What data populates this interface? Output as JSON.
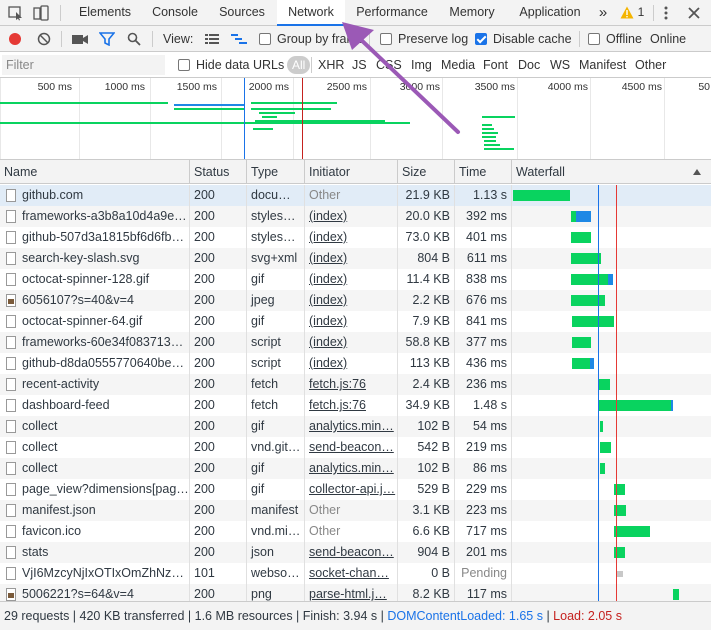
{
  "tabs": {
    "items": [
      {
        "label": "Elements"
      },
      {
        "label": "Console"
      },
      {
        "label": "Sources"
      },
      {
        "label": "Network"
      },
      {
        "label": "Performance"
      },
      {
        "label": "Memory"
      },
      {
        "label": "Application"
      }
    ],
    "more": "»",
    "warnings": "1"
  },
  "toolbar": {
    "view_label": "View:",
    "group_by_frame": "Group by frame",
    "preserve_log": "Preserve log",
    "disable_cache": "Disable cache",
    "offline": "Offline",
    "online": "Online"
  },
  "filter": {
    "placeholder": "Filter",
    "hide_data_urls": "Hide data URLs",
    "types": [
      "All",
      "XHR",
      "JS",
      "CSS",
      "Img",
      "Media",
      "Font",
      "Doc",
      "WS",
      "Manifest",
      "Other"
    ]
  },
  "overview": {
    "ticks": [
      "500 ms",
      "1000 ms",
      "1500 ms",
      "2000 ms",
      "2500 ms",
      "3000 ms",
      "3500 ms",
      "4000 ms",
      "4500 ms",
      "50"
    ]
  },
  "table": {
    "headers": {
      "name": "Name",
      "status": "Status",
      "type": "Type",
      "initiator": "Initiator",
      "size": "Size",
      "time": "Time",
      "waterfall": "Waterfall"
    },
    "rows": [
      {
        "name": "github.com",
        "status": "200",
        "type": "docu…",
        "initiator": "Other",
        "size": "21.9 KB",
        "time": "1.13 s"
      },
      {
        "name": "frameworks-a3b8a10d4a9e…",
        "status": "200",
        "type": "styles…",
        "initiator": "(index)",
        "size": "20.0 KB",
        "time": "392 ms"
      },
      {
        "name": "github-507d3a1815bf6d6fb…",
        "status": "200",
        "type": "styles…",
        "initiator": "(index)",
        "size": "73.0 KB",
        "time": "401 ms"
      },
      {
        "name": "search-key-slash.svg",
        "status": "200",
        "type": "svg+xml",
        "initiator": "(index)",
        "size": "804 B",
        "time": "611 ms"
      },
      {
        "name": "octocat-spinner-128.gif",
        "status": "200",
        "type": "gif",
        "initiator": "(index)",
        "size": "11.4 KB",
        "time": "838 ms"
      },
      {
        "name": "6056107?s=40&v=4",
        "status": "200",
        "type": "jpeg",
        "initiator": "(index)",
        "size": "2.2 KB",
        "time": "676 ms"
      },
      {
        "name": "octocat-spinner-64.gif",
        "status": "200",
        "type": "gif",
        "initiator": "(index)",
        "size": "7.9 KB",
        "time": "841 ms"
      },
      {
        "name": "frameworks-60e34f0837138…",
        "status": "200",
        "type": "script",
        "initiator": "(index)",
        "size": "58.8 KB",
        "time": "377 ms"
      },
      {
        "name": "github-d8da0555770640be…",
        "status": "200",
        "type": "script",
        "initiator": "(index)",
        "size": "113 KB",
        "time": "436 ms"
      },
      {
        "name": "recent-activity",
        "status": "200",
        "type": "fetch",
        "initiator": "fetch.js:76",
        "size": "2.4 KB",
        "time": "236 ms"
      },
      {
        "name": "dashboard-feed",
        "status": "200",
        "type": "fetch",
        "initiator": "fetch.js:76",
        "size": "34.9 KB",
        "time": "1.48 s"
      },
      {
        "name": "collect",
        "status": "200",
        "type": "gif",
        "initiator": "analytics.min…",
        "size": "102 B",
        "time": "54 ms"
      },
      {
        "name": "collect",
        "status": "200",
        "type": "vnd.git…",
        "initiator": "send-beacon…",
        "size": "542 B",
        "time": "219 ms"
      },
      {
        "name": "collect",
        "status": "200",
        "type": "gif",
        "initiator": "analytics.min…",
        "size": "102 B",
        "time": "86 ms"
      },
      {
        "name": "page_view?dimensions[pag…",
        "status": "200",
        "type": "gif",
        "initiator": "collector-api.j…",
        "size": "529 B",
        "time": "229 ms"
      },
      {
        "name": "manifest.json",
        "status": "200",
        "type": "manifest",
        "initiator": "Other",
        "size": "3.1 KB",
        "time": "223 ms"
      },
      {
        "name": "favicon.ico",
        "status": "200",
        "type": "vnd.mi…",
        "initiator": "Other",
        "size": "6.6 KB",
        "time": "717 ms"
      },
      {
        "name": "stats",
        "status": "200",
        "type": "json",
        "initiator": "send-beacon…",
        "size": "904 B",
        "time": "201 ms"
      },
      {
        "name": "VjI6MzcyNjIxOTIxOmZhNzY…",
        "status": "101",
        "type": "webso…",
        "initiator": "socket-chan…",
        "size": "0 B",
        "time": "Pending"
      },
      {
        "name": "5006221?s=64&v=4",
        "status": "200",
        "type": "png",
        "initiator": "parse-html.j…",
        "size": "8.2 KB",
        "time": "117 ms"
      }
    ]
  },
  "statusbar": {
    "summary": "29 requests | 420 KB transferred | 1.6 MB resources | Finish: 3.94 s | ",
    "dom": "DOMContentLoaded: 1.65 s",
    "divider": " | ",
    "load": "Load: 2.05 s"
  },
  "colors": {
    "accent": "#1a73e8",
    "green": "#09d35f",
    "blue_bar": "#1e88e5",
    "load_red": "#e53935",
    "dom_blue": "#1a73e8",
    "arrow": "#9b59b6"
  }
}
